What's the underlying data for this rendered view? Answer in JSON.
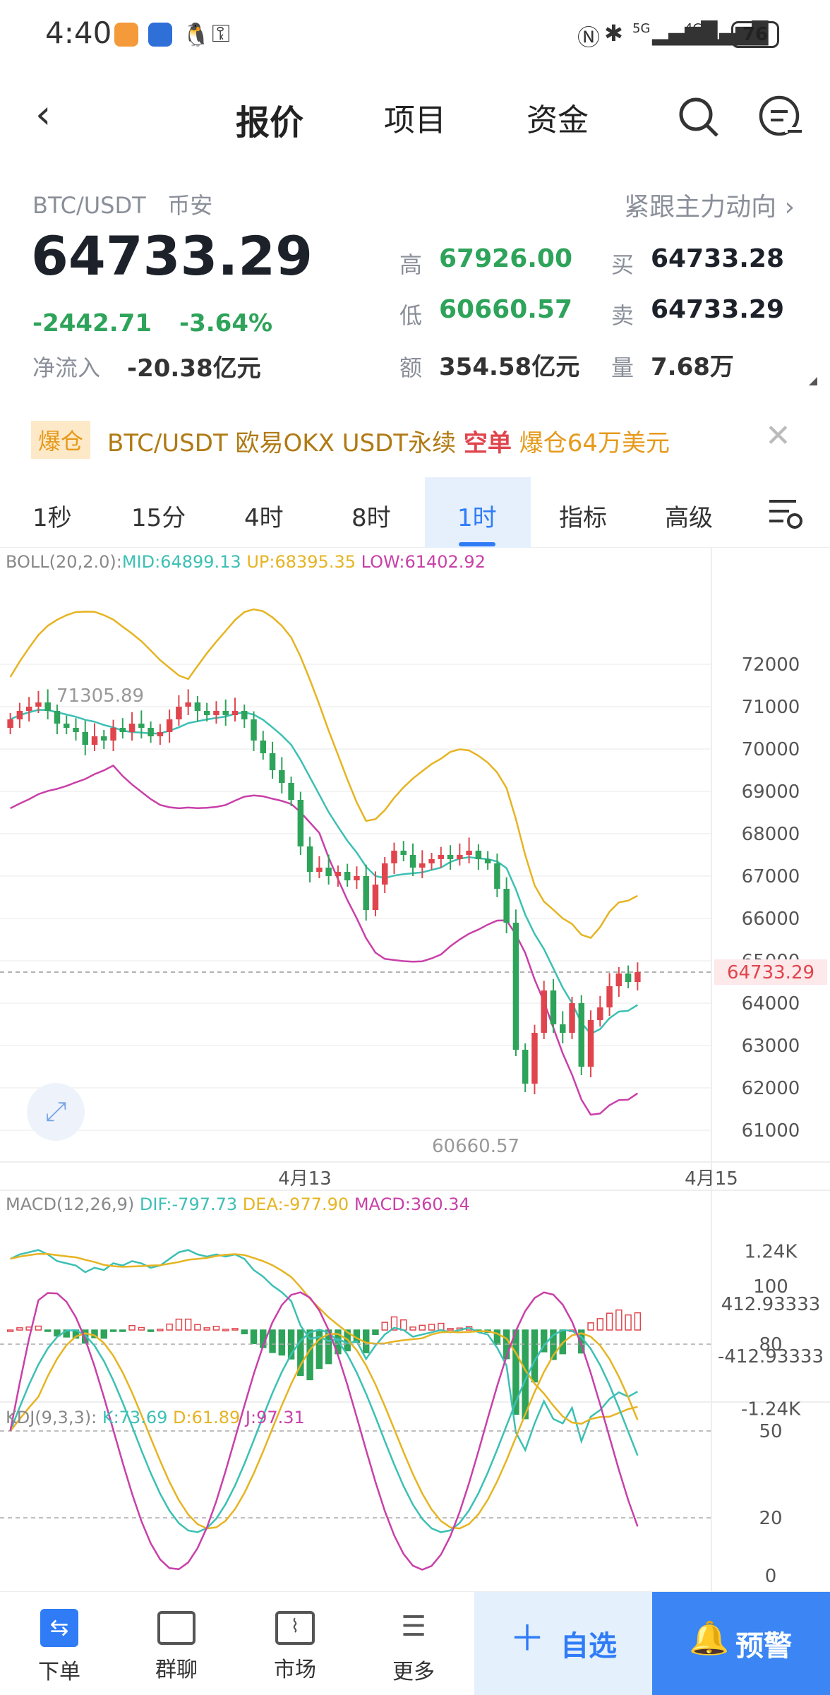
{
  "status_bar": {
    "time": "4:40",
    "battery": "76",
    "signal1": "5G",
    "signal2": "4G"
  },
  "nav": {
    "tabs": [
      "报价",
      "项目",
      "资金"
    ],
    "active": 0
  },
  "quote": {
    "pair": "BTC/USDT",
    "exchange": "币安",
    "follow_link": "紧跟主力动向 ›",
    "price": "64733.29",
    "change": "-2442.71",
    "change_pct": "-3.64%",
    "inflow_label": "净流入",
    "inflow": "-20.38亿元",
    "stats": [
      {
        "label": "高",
        "value": "67926.00"
      },
      {
        "label": "买",
        "value": "64733.28"
      },
      {
        "label": "低",
        "value": "60660.57"
      },
      {
        "label": "卖",
        "value": "64733.29"
      },
      {
        "label": "额",
        "value": "354.58亿元"
      },
      {
        "label": "量",
        "value": "7.68万"
      }
    ]
  },
  "banner": {
    "tag": "爆仓",
    "text1": "BTC/USDT 欧易OKX USDT永续",
    "text2": "空单",
    "text3": "爆仓64万美元"
  },
  "timeframes": [
    "1秒",
    "15分",
    "4时",
    "8时",
    "1时",
    "指标",
    "高级"
  ],
  "active_timeframe": "1时",
  "boll": {
    "label": "BOLL(20,2.0):",
    "mid": "MID:64899.13",
    "up": "UP:68395.35",
    "low": "LOW:61402.92"
  },
  "price_axis": [
    "72000",
    "71000",
    "70000",
    "69000",
    "68000",
    "67000",
    "66000",
    "65000",
    "64000",
    "63000",
    "62000",
    "61000"
  ],
  "current_price_tag": "64733.29",
  "high_mark": "71305.89",
  "low_mark": "60660.57",
  "dates": [
    "4月13",
    "4月15"
  ],
  "macd": {
    "label": "MACD(12,26,9)",
    "dif": "DIF:-797.73",
    "dea": "DEA:-977.90",
    "macd": "MACD:360.34",
    "axis": [
      "1.24K",
      "412.93333",
      "-412.93333",
      "-1.24K"
    ]
  },
  "kdj": {
    "label": "KDJ(9,3,3):",
    "k": "K:73.69",
    "d": "D:61.89",
    "j": "J:97.31",
    "axis": [
      "100",
      "80",
      "50",
      "20",
      "0"
    ]
  },
  "colors": {
    "up": "#e0454d",
    "down": "#2ea35a",
    "mid": "#3cc0b4",
    "upper": "#e6b422",
    "lower": "#c940a8",
    "accent": "#2f7cf6"
  },
  "bottom_nav": [
    {
      "label": "下单",
      "icon": "order-icon"
    },
    {
      "label": "群聊",
      "icon": "chat-icon"
    },
    {
      "label": "市场",
      "icon": "market-icon"
    },
    {
      "label": "更多",
      "icon": "more-icon"
    }
  ],
  "watch_button": "自选",
  "alert_button": "预警"
}
